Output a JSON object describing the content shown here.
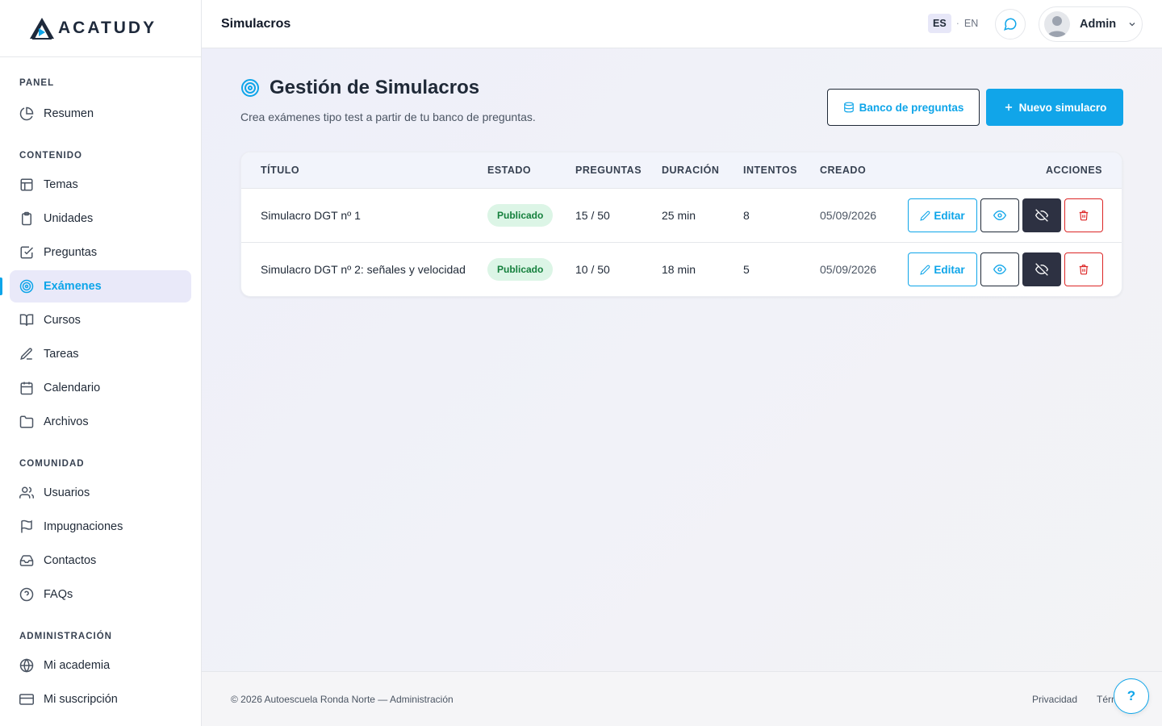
{
  "brand": {
    "name": "ACATUDY",
    "accent": "#0ea5e9"
  },
  "sidebar": {
    "sections": [
      {
        "heading": "PANEL",
        "items": [
          {
            "label": "Resumen",
            "icon": "pie-chart-icon"
          }
        ]
      },
      {
        "heading": "CONTENIDO",
        "items": [
          {
            "label": "Temas",
            "icon": "layout-icon"
          },
          {
            "label": "Unidades",
            "icon": "clipboard-icon"
          },
          {
            "label": "Preguntas",
            "icon": "check-square-icon"
          },
          {
            "label": "Exámenes",
            "icon": "target-icon",
            "active": true
          },
          {
            "label": "Cursos",
            "icon": "book-open-icon"
          },
          {
            "label": "Tareas",
            "icon": "pen-icon"
          },
          {
            "label": "Calendario",
            "icon": "calendar-icon"
          },
          {
            "label": "Archivos",
            "icon": "folder-icon"
          }
        ]
      },
      {
        "heading": "COMUNIDAD",
        "items": [
          {
            "label": "Usuarios",
            "icon": "users-icon"
          },
          {
            "label": "Impugnaciones",
            "icon": "flag-icon"
          },
          {
            "label": "Contactos",
            "icon": "inbox-icon"
          },
          {
            "label": "FAQs",
            "icon": "help-circle-icon"
          }
        ]
      },
      {
        "heading": "ADMINISTRACIÓN",
        "items": [
          {
            "label": "Mi academia",
            "icon": "globe-icon"
          },
          {
            "label": "Mi suscripción",
            "icon": "credit-card-icon"
          }
        ]
      }
    ]
  },
  "topbar": {
    "title": "Simulacros",
    "lang_active": "ES",
    "lang_sep": "·",
    "lang_other": "EN",
    "user_name": "Admin"
  },
  "page": {
    "title": "Gestión de Simulacros",
    "subtitle": "Crea exámenes tipo test a partir de tu banco de preguntas.",
    "bank_button": "Banco de preguntas",
    "new_button": "Nuevo simulacro"
  },
  "table": {
    "headers": {
      "title": "TÍTULO",
      "status": "ESTADO",
      "questions": "PREGUNTAS",
      "duration": "DURACIÓN",
      "attempts": "INTENTOS",
      "created": "CREADO",
      "actions": "ACCIONES"
    },
    "edit_label": "Editar",
    "rows": [
      {
        "title": "Simulacro DGT nº 1",
        "status": "Publicado",
        "questions": "15 / 50",
        "duration": "25 min",
        "attempts": "8",
        "created": "05/09/2026"
      },
      {
        "title": "Simulacro DGT nº 2: señales y velocidad",
        "status": "Publicado",
        "questions": "10 / 50",
        "duration": "18 min",
        "attempts": "5",
        "created": "05/09/2026"
      }
    ]
  },
  "footer": {
    "copyright": "© 2026 Autoescuela Ronda Norte — Administración",
    "privacy": "Privacidad",
    "terms": "Térm"
  },
  "help_label": "?"
}
